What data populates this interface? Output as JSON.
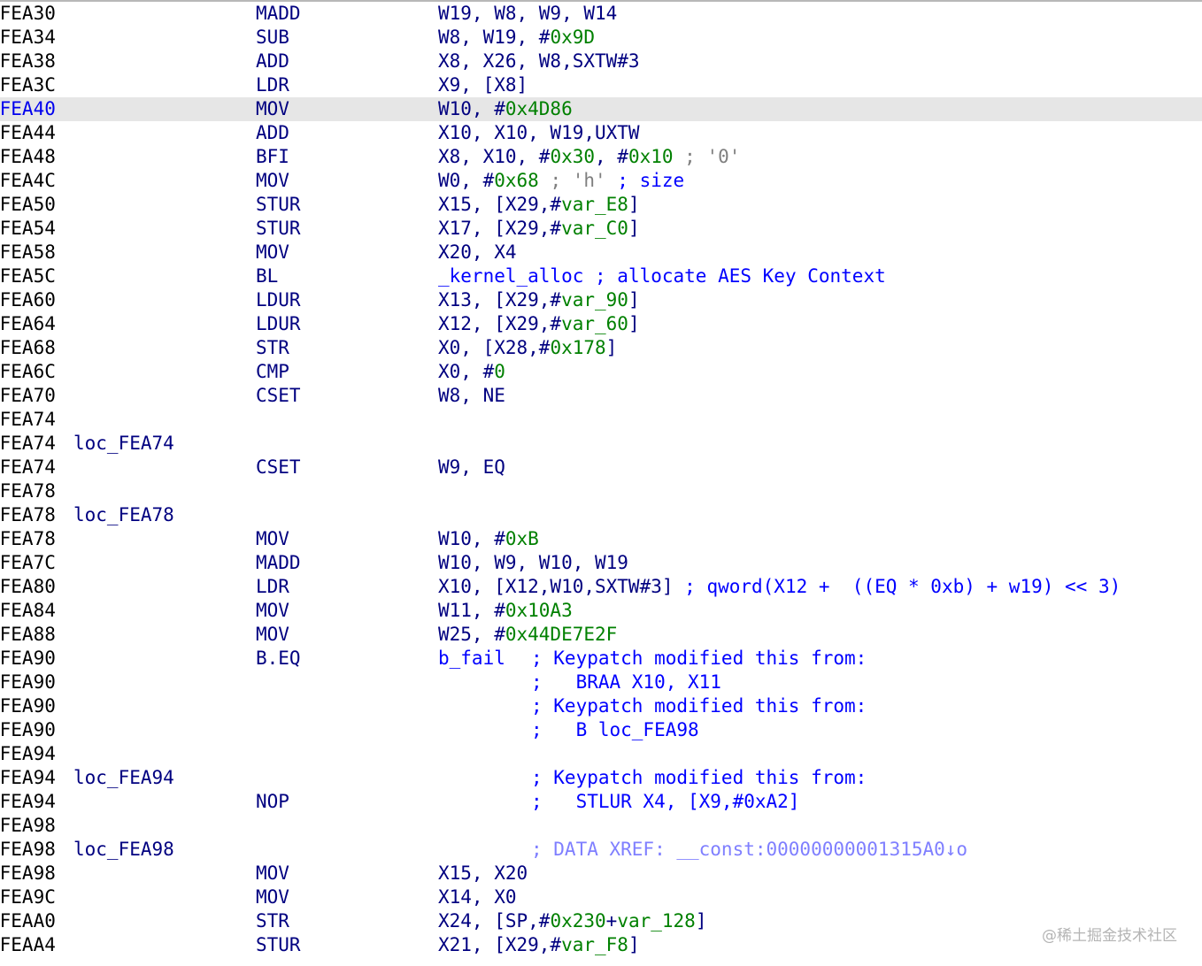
{
  "highlight_color": "#e6e6e6",
  "watermark": "@稀土掘金技术社区",
  "lines": [
    {
      "addr": "0FEA30",
      "mnemonic": "MADD",
      "operands": [
        [
          "p",
          "W19, W8, W9, W14"
        ]
      ]
    },
    {
      "addr": "0FEA34",
      "mnemonic": "SUB",
      "operands": [
        [
          "p",
          "W8, W19, #"
        ],
        [
          "n",
          "0x9D"
        ]
      ]
    },
    {
      "addr": "0FEA38",
      "mnemonic": "ADD",
      "operands": [
        [
          "p",
          "X8, X26, W8,SXTW#3"
        ]
      ]
    },
    {
      "addr": "0FEA3C",
      "mnemonic": "LDR",
      "operands": [
        [
          "p",
          "X9, [X8]"
        ]
      ]
    },
    {
      "addr": "0FEA40",
      "mnemonic": "MOV",
      "highlight": true,
      "operands": [
        [
          "p",
          "W10, #"
        ],
        [
          "n",
          "0x4D86"
        ]
      ]
    },
    {
      "addr": "0FEA44",
      "mnemonic": "ADD",
      "operands": [
        [
          "p",
          "X10, X10, W19,UXTW"
        ]
      ]
    },
    {
      "addr": "0FEA48",
      "mnemonic": "BFI",
      "operands": [
        [
          "p",
          "X8, X10, #"
        ],
        [
          "n",
          "0x30"
        ],
        [
          "p",
          ", #"
        ],
        [
          "n",
          "0x10"
        ],
        [
          "k",
          " ; '0'"
        ]
      ]
    },
    {
      "addr": "0FEA4C",
      "mnemonic": "MOV",
      "operands": [
        [
          "p",
          "W0, #"
        ],
        [
          "n",
          "0x68"
        ],
        [
          "k",
          " ; 'h'"
        ],
        [
          "b",
          " ; size"
        ]
      ]
    },
    {
      "addr": "0FEA50",
      "mnemonic": "STUR",
      "operands": [
        [
          "p",
          "X15, [X29,#"
        ],
        [
          "n",
          "var_E8"
        ],
        [
          "p",
          "]"
        ]
      ]
    },
    {
      "addr": "0FEA54",
      "mnemonic": "STUR",
      "operands": [
        [
          "p",
          "X17, [X29,#"
        ],
        [
          "n",
          "var_C0"
        ],
        [
          "p",
          "]"
        ]
      ]
    },
    {
      "addr": "0FEA58",
      "mnemonic": "MOV",
      "operands": [
        [
          "p",
          "X20, X4"
        ]
      ]
    },
    {
      "addr": "0FEA5C",
      "mnemonic": "BL",
      "operands": [
        [
          "f",
          "_kernel_alloc"
        ],
        [
          "b",
          " ; allocate AES Key Context"
        ]
      ]
    },
    {
      "addr": "0FEA60",
      "mnemonic": "LDUR",
      "operands": [
        [
          "p",
          "X13, [X29,#"
        ],
        [
          "n",
          "var_90"
        ],
        [
          "p",
          "]"
        ]
      ]
    },
    {
      "addr": "0FEA64",
      "mnemonic": "LDUR",
      "operands": [
        [
          "p",
          "X12, [X29,#"
        ],
        [
          "n",
          "var_60"
        ],
        [
          "p",
          "]"
        ]
      ]
    },
    {
      "addr": "0FEA68",
      "mnemonic": "STR",
      "operands": [
        [
          "p",
          "X0, [X28,#"
        ],
        [
          "n",
          "0x178"
        ],
        [
          "p",
          "]"
        ]
      ]
    },
    {
      "addr": "0FEA6C",
      "mnemonic": "CMP",
      "operands": [
        [
          "p",
          "X0, #"
        ],
        [
          "n",
          "0"
        ]
      ]
    },
    {
      "addr": "0FEA70",
      "mnemonic": "CSET",
      "operands": [
        [
          "p",
          "W8, NE"
        ]
      ]
    },
    {
      "addr": "0FEA74"
    },
    {
      "addr": "0FEA74",
      "label": "loc_FEA74"
    },
    {
      "addr": "0FEA74",
      "mnemonic": "CSET",
      "operands": [
        [
          "p",
          "W9, EQ"
        ]
      ]
    },
    {
      "addr": "0FEA78"
    },
    {
      "addr": "0FEA78",
      "label": "loc_FEA78"
    },
    {
      "addr": "0FEA78",
      "mnemonic": "MOV",
      "operands": [
        [
          "p",
          "W10, #"
        ],
        [
          "n",
          "0xB"
        ]
      ]
    },
    {
      "addr": "0FEA7C",
      "mnemonic": "MADD",
      "operands": [
        [
          "p",
          "W10, W9, W10, W19"
        ]
      ]
    },
    {
      "addr": "0FEA80",
      "mnemonic": "LDR",
      "operands": [
        [
          "p",
          "X10, [X12,W10,SXTW#3]"
        ],
        [
          "b",
          " ; qword(X12 +  ((EQ * 0xb) + w19) << 3)"
        ]
      ]
    },
    {
      "addr": "0FEA84",
      "mnemonic": "MOV",
      "operands": [
        [
          "p",
          "W11, #"
        ],
        [
          "n",
          "0x10A3"
        ]
      ]
    },
    {
      "addr": "0FEA88",
      "mnemonic": "MOV",
      "operands": [
        [
          "p",
          "W25, #"
        ],
        [
          "n",
          "0x44DE7E2F"
        ]
      ]
    },
    {
      "addr": "0FEA90",
      "mnemonic": "B.EQ",
      "operands": [
        [
          "f",
          "b_fail"
        ]
      ],
      "comment": [
        [
          "b",
          "; Keypatch modified this from:"
        ]
      ]
    },
    {
      "addr": "0FEA90",
      "comment": [
        [
          "b",
          ";   BRAA X10, X11"
        ]
      ]
    },
    {
      "addr": "0FEA90",
      "comment": [
        [
          "b",
          "; Keypatch modified this from:"
        ]
      ]
    },
    {
      "addr": "0FEA90",
      "comment": [
        [
          "b",
          ";   B loc_FEA98"
        ]
      ]
    },
    {
      "addr": "0FEA94"
    },
    {
      "addr": "0FEA94",
      "label": "loc_FEA94",
      "comment": [
        [
          "b",
          "; Keypatch modified this from:"
        ]
      ]
    },
    {
      "addr": "0FEA94",
      "mnemonic": "NOP",
      "comment": [
        [
          "b",
          ";   STLUR X4, [X9,#0xA2]"
        ]
      ]
    },
    {
      "addr": "0FEA98"
    },
    {
      "addr": "0FEA98",
      "label": "loc_FEA98",
      "comment": [
        [
          "x",
          "; DATA XREF: __const:00000000001315A0↓o"
        ]
      ]
    },
    {
      "addr": "0FEA98",
      "mnemonic": "MOV",
      "operands": [
        [
          "p",
          "X15, X20"
        ]
      ]
    },
    {
      "addr": "0FEA9C",
      "mnemonic": "MOV",
      "operands": [
        [
          "p",
          "X14, X0"
        ]
      ]
    },
    {
      "addr": "0FEAA0",
      "mnemonic": "STR",
      "operands": [
        [
          "p",
          "X24, [SP,#"
        ],
        [
          "n",
          "0x230"
        ],
        [
          "p",
          "+"
        ],
        [
          "n",
          "var_128"
        ],
        [
          "p",
          "]"
        ]
      ]
    },
    {
      "addr": "0FEAA4",
      "mnemonic": "STUR",
      "operands": [
        [
          "p",
          "X21, [X29,#"
        ],
        [
          "n",
          "var_F8"
        ],
        [
          "p",
          "]"
        ]
      ]
    }
  ]
}
